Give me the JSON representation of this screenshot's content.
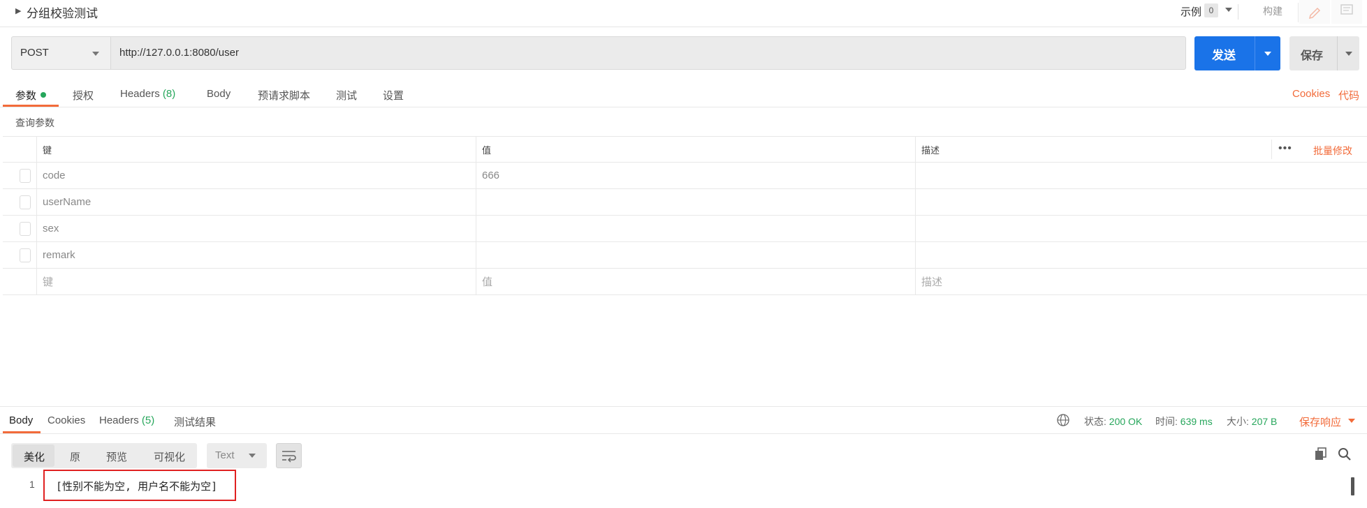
{
  "header": {
    "title": "分组校验测试",
    "examples_label": "示例",
    "examples_count": "0",
    "build_label": "构建"
  },
  "request": {
    "method": "POST",
    "url": "http://127.0.0.1:8080/user",
    "send_label": "发送",
    "save_label": "保存"
  },
  "request_tabs": {
    "params": "参数",
    "auth": "授权",
    "headers": "Headers",
    "headers_count": "(8)",
    "body": "Body",
    "prerequest": "预请求脚本",
    "tests": "测试",
    "settings": "设置",
    "cookies": "Cookies",
    "code": "代码"
  },
  "params": {
    "section_label": "查询参数",
    "columns": {
      "key": "键",
      "value": "值",
      "description": "描述"
    },
    "bulk_edit": "批量修改",
    "more": "•••",
    "rows": [
      {
        "key": "code",
        "value": "666",
        "description": ""
      },
      {
        "key": "userName",
        "value": "",
        "description": ""
      },
      {
        "key": "sex",
        "value": "",
        "description": ""
      },
      {
        "key": "remark",
        "value": "",
        "description": ""
      }
    ],
    "placeholders": {
      "key": "键",
      "value": "值",
      "description": "描述"
    }
  },
  "response": {
    "tabs": {
      "body": "Body",
      "cookies": "Cookies",
      "headers": "Headers",
      "headers_count": "(5)",
      "test_results": "测试结果"
    },
    "status_label": "状态:",
    "status_value": "200 OK",
    "time_label": "时间:",
    "time_value": "639 ms",
    "size_label": "大小:",
    "size_value": "207 B",
    "save_response": "保存响应",
    "view_modes": [
      "美化",
      "原",
      "预览",
      "可视化"
    ],
    "format": "Text",
    "line_number": "1",
    "body_text": "[性别不能为空, 用户名不能为空]"
  },
  "colors": {
    "accent": "#f26b3a",
    "primary": "#1a73e8",
    "success": "#26a65b",
    "highlight_box": "#e02020"
  }
}
